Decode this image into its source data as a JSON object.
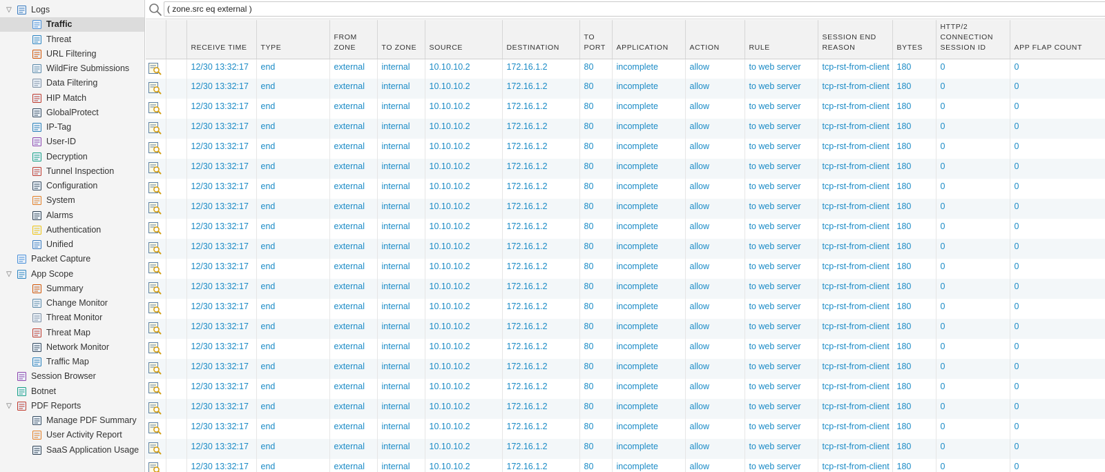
{
  "sidebar": {
    "items": [
      {
        "label": "Logs",
        "icon": "logs-folder-icon",
        "twisty": "▽"
      },
      {
        "label": "Traffic",
        "icon": "traffic-log-icon",
        "selected": true
      },
      {
        "label": "Threat",
        "icon": "threat-log-icon"
      },
      {
        "label": "URL Filtering",
        "icon": "url-filtering-icon"
      },
      {
        "label": "WildFire Submissions",
        "icon": "wildfire-icon"
      },
      {
        "label": "Data Filtering",
        "icon": "data-filtering-icon"
      },
      {
        "label": "HIP Match",
        "icon": "hip-match-icon"
      },
      {
        "label": "GlobalProtect",
        "icon": "globalprotect-icon"
      },
      {
        "label": "IP-Tag",
        "icon": "ip-tag-icon"
      },
      {
        "label": "User-ID",
        "icon": "user-id-icon"
      },
      {
        "label": "Decryption",
        "icon": "decryption-icon"
      },
      {
        "label": "Tunnel Inspection",
        "icon": "tunnel-inspection-icon"
      },
      {
        "label": "Configuration",
        "icon": "configuration-icon"
      },
      {
        "label": "System",
        "icon": "system-icon"
      },
      {
        "label": "Alarms",
        "icon": "alarms-icon"
      },
      {
        "label": "Authentication",
        "icon": "authentication-icon"
      },
      {
        "label": "Unified",
        "icon": "unified-icon"
      },
      {
        "label": "Packet Capture",
        "icon": "packet-capture-icon"
      },
      {
        "label": "App Scope",
        "icon": "app-scope-icon",
        "twisty": "▽"
      },
      {
        "label": "Summary",
        "icon": "summary-icon"
      },
      {
        "label": "Change Monitor",
        "icon": "change-monitor-icon"
      },
      {
        "label": "Threat Monitor",
        "icon": "threat-monitor-icon"
      },
      {
        "label": "Threat Map",
        "icon": "threat-map-icon"
      },
      {
        "label": "Network Monitor",
        "icon": "network-monitor-icon"
      },
      {
        "label": "Traffic Map",
        "icon": "traffic-map-icon"
      },
      {
        "label": "Session Browser",
        "icon": "session-browser-icon"
      },
      {
        "label": "Botnet",
        "icon": "botnet-icon"
      },
      {
        "label": "PDF Reports",
        "icon": "pdf-reports-icon",
        "twisty": "▽"
      },
      {
        "label": "Manage PDF Summary",
        "icon": "manage-pdf-summary-icon"
      },
      {
        "label": "User Activity Report",
        "icon": "user-activity-report-icon"
      },
      {
        "label": "SaaS Application Usage",
        "icon": "saas-usage-icon"
      }
    ]
  },
  "search": {
    "value": "( zone.src eq external )",
    "icon": "search-icon"
  },
  "table": {
    "columns": [
      "",
      "",
      "RECEIVE TIME",
      "TYPE",
      "FROM ZONE",
      "TO ZONE",
      "SOURCE",
      "DESTINATION",
      "TO PORT",
      "APPLICATION",
      "ACTION",
      "RULE",
      "SESSION END REASON",
      "BYTES",
      "HTTP/2 CONNECTION SESSION ID",
      "APP FLAP COUNT"
    ],
    "detail_icon": "log-detail-magnifier-icon",
    "rows": [
      [
        "12/30 13:32:17",
        "end",
        "external",
        "internal",
        "10.10.10.2",
        "172.16.1.2",
        "80",
        "incomplete",
        "allow",
        "to web server",
        "tcp-rst-from-client",
        "180",
        "0",
        "0"
      ],
      [
        "12/30 13:32:17",
        "end",
        "external",
        "internal",
        "10.10.10.2",
        "172.16.1.2",
        "80",
        "incomplete",
        "allow",
        "to web server",
        "tcp-rst-from-client",
        "180",
        "0",
        "0"
      ],
      [
        "12/30 13:32:17",
        "end",
        "external",
        "internal",
        "10.10.10.2",
        "172.16.1.2",
        "80",
        "incomplete",
        "allow",
        "to web server",
        "tcp-rst-from-client",
        "180",
        "0",
        "0"
      ],
      [
        "12/30 13:32:17",
        "end",
        "external",
        "internal",
        "10.10.10.2",
        "172.16.1.2",
        "80",
        "incomplete",
        "allow",
        "to web server",
        "tcp-rst-from-client",
        "180",
        "0",
        "0"
      ],
      [
        "12/30 13:32:17",
        "end",
        "external",
        "internal",
        "10.10.10.2",
        "172.16.1.2",
        "80",
        "incomplete",
        "allow",
        "to web server",
        "tcp-rst-from-client",
        "180",
        "0",
        "0"
      ],
      [
        "12/30 13:32:17",
        "end",
        "external",
        "internal",
        "10.10.10.2",
        "172.16.1.2",
        "80",
        "incomplete",
        "allow",
        "to web server",
        "tcp-rst-from-client",
        "180",
        "0",
        "0"
      ],
      [
        "12/30 13:32:17",
        "end",
        "external",
        "internal",
        "10.10.10.2",
        "172.16.1.2",
        "80",
        "incomplete",
        "allow",
        "to web server",
        "tcp-rst-from-client",
        "180",
        "0",
        "0"
      ],
      [
        "12/30 13:32:17",
        "end",
        "external",
        "internal",
        "10.10.10.2",
        "172.16.1.2",
        "80",
        "incomplete",
        "allow",
        "to web server",
        "tcp-rst-from-client",
        "180",
        "0",
        "0"
      ],
      [
        "12/30 13:32:17",
        "end",
        "external",
        "internal",
        "10.10.10.2",
        "172.16.1.2",
        "80",
        "incomplete",
        "allow",
        "to web server",
        "tcp-rst-from-client",
        "180",
        "0",
        "0"
      ],
      [
        "12/30 13:32:17",
        "end",
        "external",
        "internal",
        "10.10.10.2",
        "172.16.1.2",
        "80",
        "incomplete",
        "allow",
        "to web server",
        "tcp-rst-from-client",
        "180",
        "0",
        "0"
      ],
      [
        "12/30 13:32:17",
        "end",
        "external",
        "internal",
        "10.10.10.2",
        "172.16.1.2",
        "80",
        "incomplete",
        "allow",
        "to web server",
        "tcp-rst-from-client",
        "180",
        "0",
        "0"
      ],
      [
        "12/30 13:32:17",
        "end",
        "external",
        "internal",
        "10.10.10.2",
        "172.16.1.2",
        "80",
        "incomplete",
        "allow",
        "to web server",
        "tcp-rst-from-client",
        "180",
        "0",
        "0"
      ],
      [
        "12/30 13:32:17",
        "end",
        "external",
        "internal",
        "10.10.10.2",
        "172.16.1.2",
        "80",
        "incomplete",
        "allow",
        "to web server",
        "tcp-rst-from-client",
        "180",
        "0",
        "0"
      ],
      [
        "12/30 13:32:17",
        "end",
        "external",
        "internal",
        "10.10.10.2",
        "172.16.1.2",
        "80",
        "incomplete",
        "allow",
        "to web server",
        "tcp-rst-from-client",
        "180",
        "0",
        "0"
      ],
      [
        "12/30 13:32:17",
        "end",
        "external",
        "internal",
        "10.10.10.2",
        "172.16.1.2",
        "80",
        "incomplete",
        "allow",
        "to web server",
        "tcp-rst-from-client",
        "180",
        "0",
        "0"
      ],
      [
        "12/30 13:32:17",
        "end",
        "external",
        "internal",
        "10.10.10.2",
        "172.16.1.2",
        "80",
        "incomplete",
        "allow",
        "to web server",
        "tcp-rst-from-client",
        "180",
        "0",
        "0"
      ],
      [
        "12/30 13:32:17",
        "end",
        "external",
        "internal",
        "10.10.10.2",
        "172.16.1.2",
        "80",
        "incomplete",
        "allow",
        "to web server",
        "tcp-rst-from-client",
        "180",
        "0",
        "0"
      ],
      [
        "12/30 13:32:17",
        "end",
        "external",
        "internal",
        "10.10.10.2",
        "172.16.1.2",
        "80",
        "incomplete",
        "allow",
        "to web server",
        "tcp-rst-from-client",
        "180",
        "0",
        "0"
      ],
      [
        "12/30 13:32:17",
        "end",
        "external",
        "internal",
        "10.10.10.2",
        "172.16.1.2",
        "80",
        "incomplete",
        "allow",
        "to web server",
        "tcp-rst-from-client",
        "180",
        "0",
        "0"
      ],
      [
        "12/30 13:32:17",
        "end",
        "external",
        "internal",
        "10.10.10.2",
        "172.16.1.2",
        "80",
        "incomplete",
        "allow",
        "to web server",
        "tcp-rst-from-client",
        "180",
        "0",
        "0"
      ],
      [
        "12/30 13:32:17",
        "end",
        "external",
        "internal",
        "10.10.10.2",
        "172.16.1.2",
        "80",
        "incomplete",
        "allow",
        "to web server",
        "tcp-rst-from-client",
        "180",
        "0",
        "0"
      ]
    ]
  },
  "colors": {
    "link": "#1b8bc6",
    "row_alt": "#f3f7f9",
    "header_bg": "#f2f2f2",
    "sidebar_bg": "#f4f4f4",
    "selected_bg": "#dcdcdc"
  }
}
